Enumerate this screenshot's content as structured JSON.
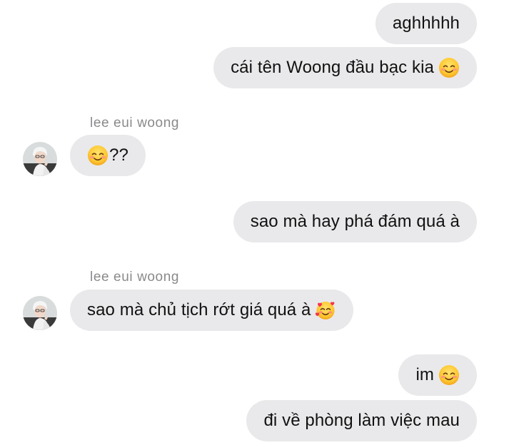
{
  "messages": [
    {
      "id": "m1",
      "direction": "outgoing",
      "text": "aghhhhh",
      "emoji": null
    },
    {
      "id": "m2",
      "direction": "outgoing",
      "text": "cái tên Woong đầu bạc kia",
      "emoji": "smiling-face-emoji"
    },
    {
      "id": "m3",
      "direction": "incoming",
      "sender": "lee eui woong",
      "text": "??",
      "emoji": "smiling-face-emoji"
    },
    {
      "id": "m4",
      "direction": "outgoing",
      "text": "sao mà hay phá đám quá à",
      "emoji": null
    },
    {
      "id": "m5",
      "direction": "incoming",
      "sender": "lee eui woong",
      "text": "sao mà chủ tịch rớt giá quá à",
      "emoji": "smiling-face-with-hearts-emoji"
    },
    {
      "id": "m6",
      "direction": "outgoing",
      "text": "im",
      "emoji": "smiling-face-emoji"
    },
    {
      "id": "m7",
      "direction": "outgoing",
      "text": "đi về phòng làm việc mau",
      "emoji": null
    }
  ],
  "colors": {
    "bubble": "#e9e9eb",
    "sender_name": "#8a8a8e",
    "text": "#111111"
  }
}
